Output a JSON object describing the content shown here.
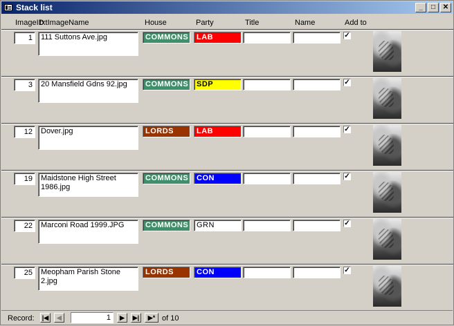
{
  "window": {
    "title": "Stack list"
  },
  "columns": {
    "image_id": "ImageID",
    "image_name": "txtImageName",
    "house": "House",
    "party": "Party",
    "title": "Title",
    "name": "Name",
    "add_to": "Add to"
  },
  "rows": [
    {
      "id": "1",
      "name": "111 Suttons Ave.jpg",
      "house": "COMMONS",
      "party": "LAB",
      "title": "",
      "person": "",
      "add_to": true
    },
    {
      "id": "3",
      "name": "20 Mansfield Gdns 92.jpg",
      "house": "COMMONS",
      "party": "SDP",
      "title": "",
      "person": "",
      "add_to": true
    },
    {
      "id": "12",
      "name": "Dover.jpg",
      "house": "LORDS",
      "party": "LAB",
      "title": "",
      "person": "",
      "add_to": true
    },
    {
      "id": "19",
      "name": "Maidstone High Street 1986.jpg",
      "house": "COMMONS",
      "party": "CON",
      "title": "",
      "person": "",
      "add_to": true
    },
    {
      "id": "22",
      "name": "Marconi Road 1999.JPG",
      "house": "COMMONS",
      "party": "GRN",
      "title": "",
      "person": "",
      "add_to": true
    },
    {
      "id": "25",
      "name": "Meopham Parish Stone 2.jpg",
      "house": "LORDS",
      "party": "CON",
      "title": "",
      "person": "",
      "add_to": true
    }
  ],
  "colors": {
    "COMMONS": "#3f8f6a",
    "LORDS": "#993300",
    "LAB": "#ff0000",
    "SDP": "#ffff00",
    "CON": "#0000ff",
    "GRN": "#ffffff"
  },
  "text_colors": {
    "SDP": "#000000",
    "GRN": "#000000"
  },
  "navigation": {
    "label": "Record:",
    "current": "1",
    "of_label": "of",
    "total": "10"
  },
  "icons": {
    "first": "first-record-icon",
    "prev": "previous-record-icon",
    "next": "next-record-icon",
    "last": "last-record-icon",
    "new": "new-record-icon"
  }
}
